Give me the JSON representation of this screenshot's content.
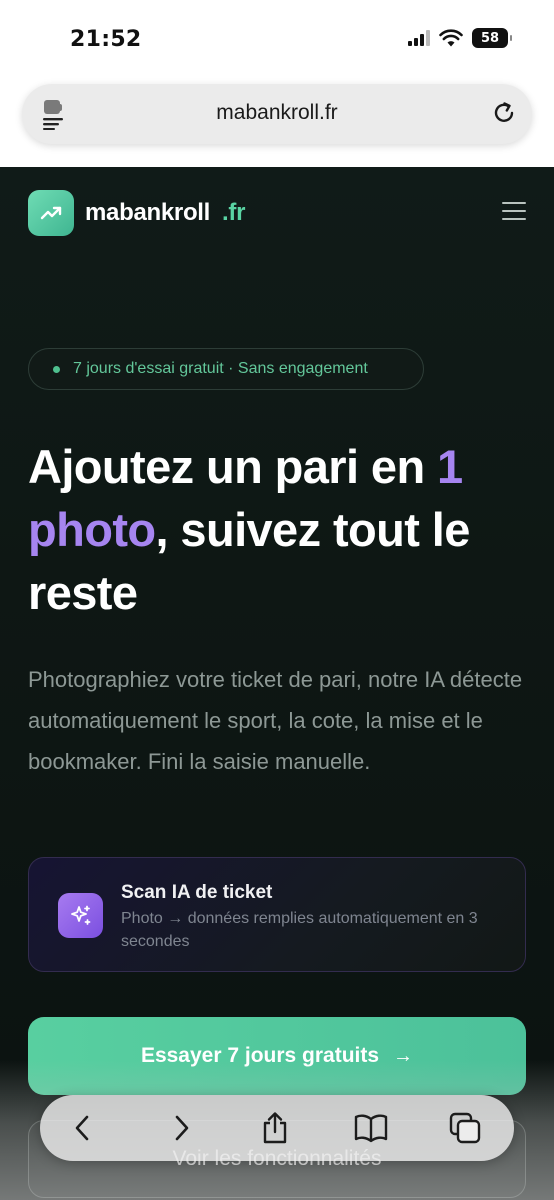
{
  "status_bar": {
    "time": "21:52",
    "battery": "58"
  },
  "browser": {
    "url": "mabankroll.fr"
  },
  "nav": {
    "brand_name": "mabankroll",
    "brand_tld": ".fr"
  },
  "badge": {
    "text": "7 jours d'essai gratuit · Sans engagement"
  },
  "hero": {
    "title_part1": "Ajoutez un pari en ",
    "title_accent": "1 photo",
    "title_part2": ", suivez tout le reste",
    "description": "Photographiez votre ticket de pari, notre IA détecte automatiquement le sport, la cote, la mise et le bookmaker. Fini la saisie manuelle."
  },
  "feature": {
    "title": "Scan IA de ticket",
    "subtitle": "Photo → données remplies automatiquement en 3 secondes",
    "icon": "sparkles-icon"
  },
  "cta": {
    "primary_label": "Essayer 7 jours gratuits",
    "primary_arrow": "→",
    "secondary_label": "Voir les fonctionnalités"
  },
  "colors": {
    "accent_green": "#58cfa0",
    "accent_purple": "#a685f0",
    "background": "#0e1714"
  }
}
